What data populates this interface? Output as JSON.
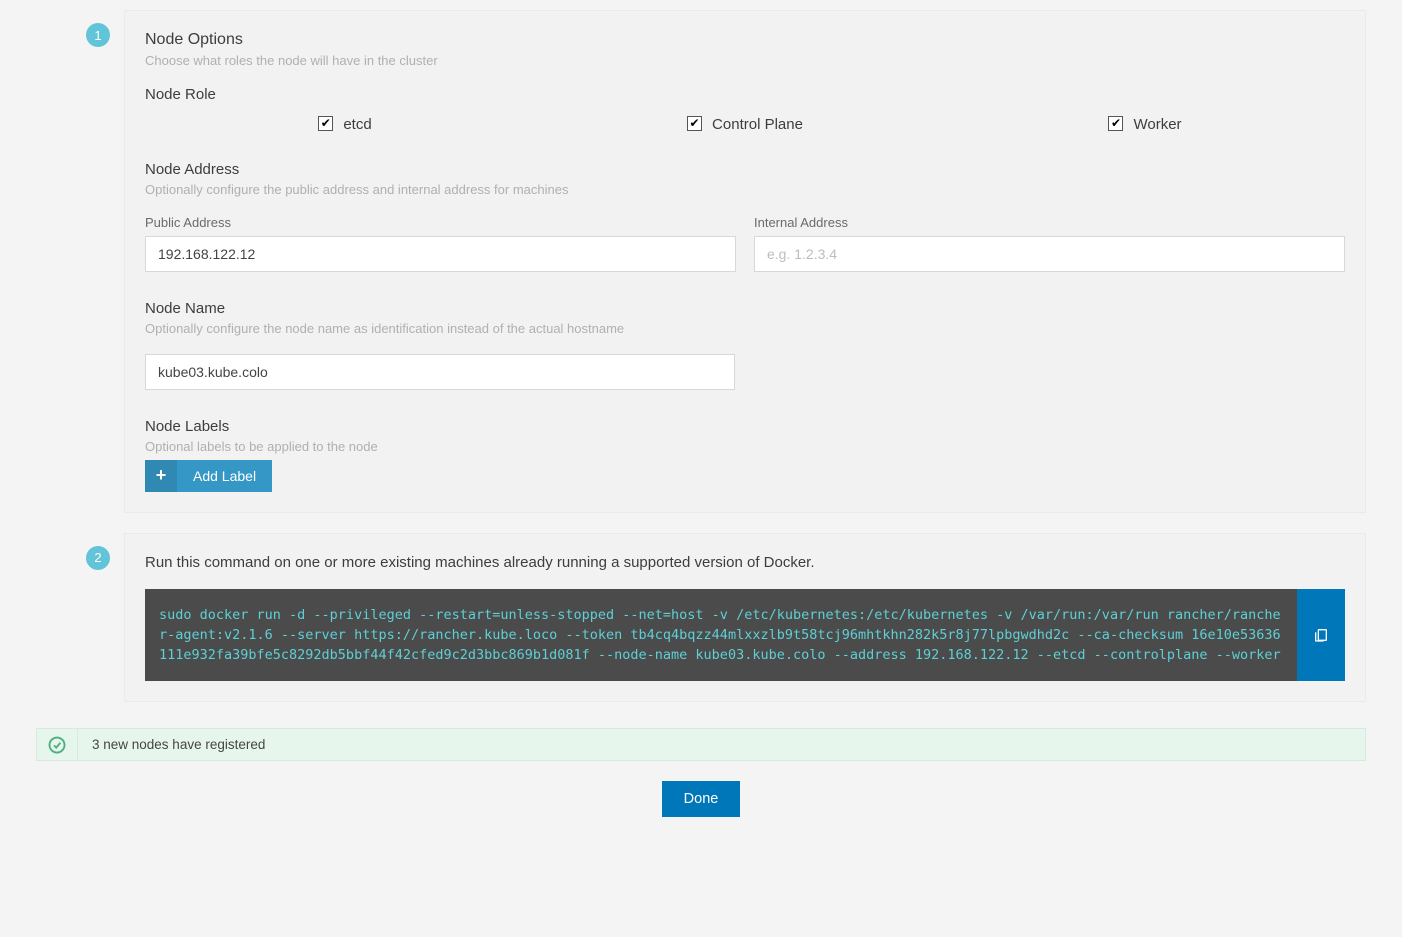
{
  "step1": {
    "badge": "1",
    "title": "Node Options",
    "subtitle": "Choose what roles the node will have in the cluster",
    "role": {
      "heading": "Node Role",
      "options": [
        {
          "label": "etcd",
          "checked": true
        },
        {
          "label": "Control Plane",
          "checked": true
        },
        {
          "label": "Worker",
          "checked": true
        }
      ]
    },
    "address": {
      "heading": "Node Address",
      "subtitle": "Optionally configure the public address and internal address for machines",
      "public": {
        "label": "Public Address",
        "value": "192.168.122.12"
      },
      "internal": {
        "label": "Internal Address",
        "value": "",
        "placeholder": "e.g. 1.2.3.4"
      }
    },
    "name": {
      "heading": "Node Name",
      "subtitle": "Optionally configure the node name as identification instead of the actual hostname",
      "value": "kube03.kube.colo"
    },
    "labels": {
      "heading": "Node Labels",
      "subtitle": "Optional labels to be applied to the node",
      "add_button": "Add Label"
    }
  },
  "step2": {
    "badge": "2",
    "instruction": "Run this command on one or more existing machines already running a supported version of Docker.",
    "command": "sudo docker run -d --privileged --restart=unless-stopped --net=host -v /etc/kubernetes:/etc/kubernetes -v /var/run:/var/run rancher/rancher-agent:v2.1.6 --server https://rancher.kube.loco --token tb4cq4bqzz44mlxxzlb9t58tcj96mhtkhn282k5r8j77lpbgwdhd2c --ca-checksum 16e10e53636111e932fa39bfe5c8292db5bbf44f42cfed9c2d3bbc869b1d081f --node-name kube03.kube.colo --address 192.168.122.12 --etcd --controlplane --worker"
  },
  "status": {
    "message": "3 new nodes have registered"
  },
  "done_button": "Done"
}
